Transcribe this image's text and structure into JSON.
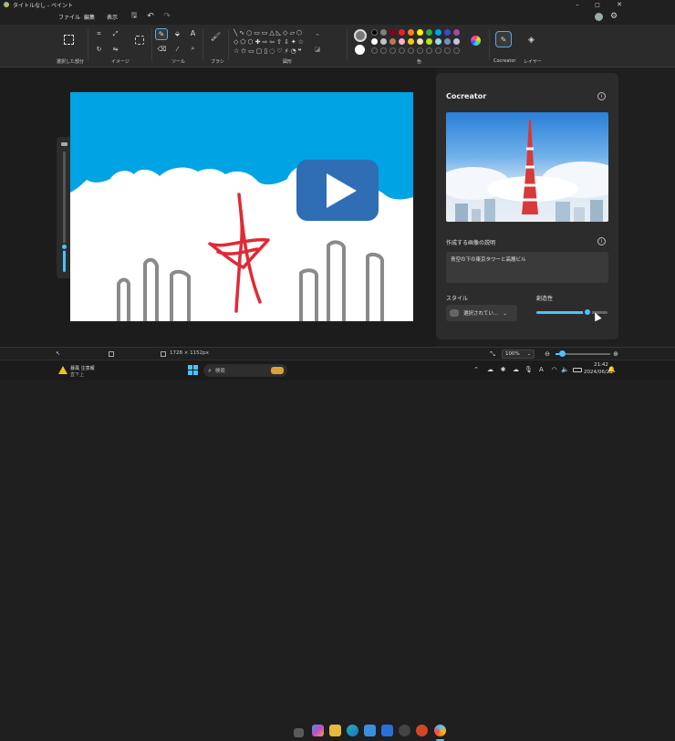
{
  "app": {
    "title": "タイトルなし - ペイント"
  },
  "menu": {
    "file": "ファイル",
    "edit": "編集",
    "view": "表示"
  },
  "ribbon": {
    "groups": {
      "selection": "選択した部分",
      "image": "イメージ",
      "tools": "ツール",
      "brush": "ブラシ",
      "shapes": "図形",
      "colors": "色",
      "cocreator": "Cocreator",
      "layers": "レイヤー"
    },
    "palette_row1": [
      "#000000",
      "#7f7f7f",
      "#880015",
      "#ed1c24",
      "#ff7f27",
      "#fff200",
      "#22b14c",
      "#00a2e8",
      "#3f48cc",
      "#a349a4"
    ],
    "palette_row2": [
      "#ffffff",
      "#c3c3c3",
      "#b97a57",
      "#ffaec9",
      "#ffc90e",
      "#efe4b0",
      "#b5e61d",
      "#99d9ea",
      "#7092be",
      "#c8bfe7"
    ]
  },
  "panel": {
    "title": "Cocreator",
    "prompt_label": "作成する画像の説明",
    "prompt_value": "青空の下の東京タワーと高層ビル",
    "style_label": "スタイル",
    "style_value": "選択されてい...",
    "creativity_label": "創造性",
    "creativity_level": 0.72
  },
  "status": {
    "dimensions": "1728 × 1152px",
    "zoom": "100%"
  },
  "taskbar": {
    "weather_temp": "暴風 注意報",
    "weather_desc": "直下上",
    "search_placeholder": "検索",
    "time": "21:42",
    "date": "2024/06/23",
    "keyboard": "A"
  },
  "colors": {
    "accent": "#4cc2ff",
    "sky": "#00a3e4",
    "tower": "#e02a35",
    "building": "#8a8a8a"
  }
}
